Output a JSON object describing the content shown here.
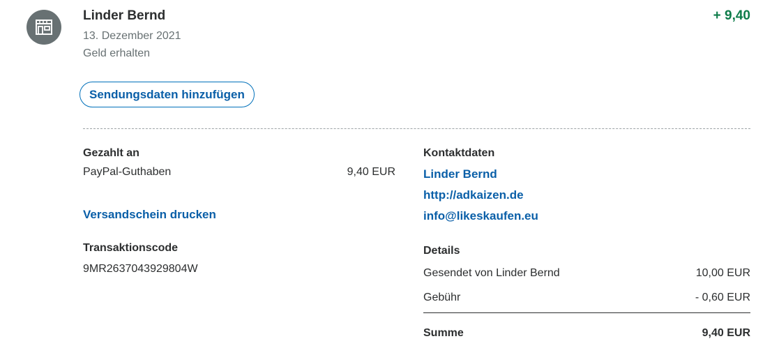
{
  "header": {
    "name": "Linder Bernd",
    "date": "13. Dezember 2021",
    "type": "Geld erhalten",
    "amount": "+ 9,40"
  },
  "shipping_button": "Sendungsdaten hinzufügen",
  "paid_to": {
    "label": "Gezahlt an",
    "method": "PayPal-Guthaben",
    "amount": "9,40 EUR"
  },
  "print_label_link": "Versandschein drucken",
  "transaction": {
    "label": "Transaktionscode",
    "code": "9MR2637043929804W"
  },
  "contact": {
    "label": "Kontaktdaten",
    "name": "Linder Bernd",
    "website": "http://adkaizen.de",
    "email": "info@likeskaufen.eu"
  },
  "details": {
    "label": "Details",
    "rows": [
      {
        "label": "Gesendet von Linder Bernd",
        "value": "10,00 EUR"
      },
      {
        "label": "Gebühr",
        "value": "- 0,60 EUR"
      }
    ],
    "total_label": "Summe",
    "total_value": "9,40 EUR"
  },
  "icons": {
    "avatar": "store-icon"
  },
  "colors": {
    "positive": "#0e7c4a",
    "link": "#0a5fa8",
    "avatar_bg": "#687173"
  }
}
